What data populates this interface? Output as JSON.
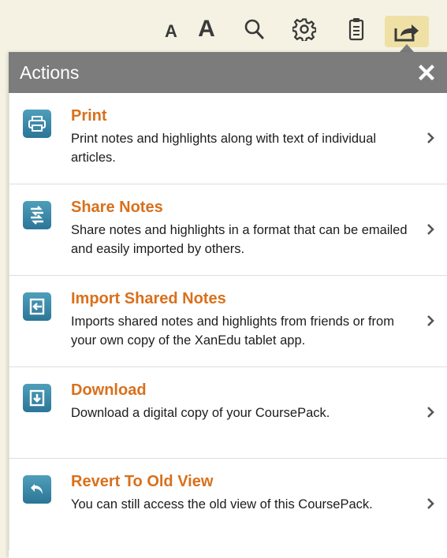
{
  "toolbar": {
    "font_small_label": "A",
    "font_large_label": "A",
    "icons": [
      "search-icon",
      "gear-icon",
      "notes-icon",
      "share-icon"
    ],
    "active_tool": "share",
    "active_color": "#efe0a6"
  },
  "panel": {
    "title": "Actions",
    "close_icon": "close-icon",
    "header_color": "#7c7c7c",
    "accent_title_color": "#d9701b",
    "icon_color": "#3a88a8",
    "items": [
      {
        "title": "Print",
        "description": "Print notes and highlights along with text of individual articles.",
        "icon": "printer-icon"
      },
      {
        "title": "Share Notes",
        "description": "Share notes and highlights in a format that can be emailed and easily imported by others.",
        "icon": "share-notes-icon"
      },
      {
        "title": "Import Shared Notes",
        "description": "Imports shared notes and highlights from friends or from your own copy of the XanEdu tablet app.",
        "icon": "import-icon"
      },
      {
        "title": "Download",
        "description": "Download a digital copy of your CoursePack.",
        "icon": "download-icon"
      },
      {
        "title": "Revert To Old View",
        "description": "You can still access the old view of this CoursePack.",
        "icon": "revert-icon"
      }
    ]
  }
}
